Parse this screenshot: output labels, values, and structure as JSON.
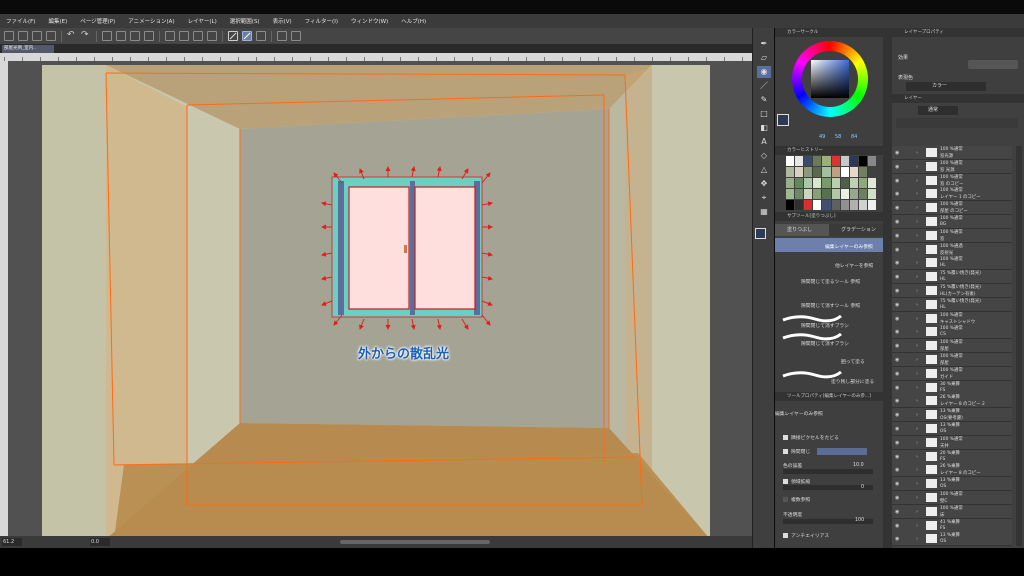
{
  "menubar": {
    "items": [
      "ファイル(F)",
      "編集(E)",
      "ページ管理(P)",
      "アニメーション(A)",
      "レイヤー(L)",
      "選択範囲(S)",
      "表示(V)",
      "フィルター(I)",
      "ウィンドウ(W)",
      "ヘルプ(H)"
    ]
  },
  "document": {
    "tab_title": "部屋光例_室内.."
  },
  "canvas": {
    "annotation": "外からの散乱光"
  },
  "status": {
    "zoom": "61.2",
    "angle": "0.0"
  },
  "colorwheel_panel": {
    "title": "カラーサークル",
    "values": [
      "49",
      "58",
      "84"
    ]
  },
  "history_panel": {
    "title": "カラーヒストリー"
  },
  "subtool_panel": {
    "title": "サブツール[塗りつぶし]",
    "tabs": [
      "塗りつぶし",
      "グラデーション"
    ],
    "items": [
      "編集レイヤーのみ参照",
      "他レイヤーを参照",
      "隙間閉じて塗るツール 参照",
      "隙間閉じて消すツール 参照",
      "隙間閉じて消すブラシ",
      "隙間閉じて消すブラシ",
      "囲って塗る",
      "塗り残し部分に塗る"
    ]
  },
  "toolprop_panel": {
    "title": "ツールプロパティ[編集レイヤーのみ参...]",
    "subtitle": "編集レイヤーのみ参照",
    "rows": {
      "follow_adjacent": "隣接ピクセルをたどる",
      "close_gap": "隙間閉じ",
      "color_margin": "色の誤差",
      "color_margin_value": "10.0",
      "area_scaling": "領域拡縮",
      "area_scaling_value": "0",
      "multi_ref": "複数参照",
      "opacity": "不透明度",
      "opacity_value": "100",
      "antialias": "アンチエイリアス"
    }
  },
  "layerprop_panel": {
    "title": "レイヤープロパティ",
    "effect_label": "効果",
    "expression_label": "表現色",
    "expression_value": "カラー"
  },
  "layer_panel": {
    "title": "レイヤー",
    "blend_mode": "通常",
    "layers": [
      {
        "blend": "100 %通常",
        "name": "窓光源"
      },
      {
        "blend": "100 %通常",
        "name": "窓 光源"
      },
      {
        "blend": "100 %通常",
        "name": "窓 のコピー"
      },
      {
        "blend": "100 %通常",
        "name": "レイヤー 1 のコピー"
      },
      {
        "blend": "100 %通常",
        "name": "部屋 のコピー"
      },
      {
        "blend": "100 %通常",
        "name": "BG"
      },
      {
        "blend": "100 %通常",
        "name": "窓"
      },
      {
        "blend": "100 %通過",
        "name": "反射光"
      },
      {
        "blend": "100 %通常",
        "name": "HL"
      },
      {
        "blend": "75 %覆い焼き(発光)",
        "name": "HL"
      },
      {
        "blend": "75 %覆い焼き(発光)",
        "name": "HL(カーテン有後)"
      },
      {
        "blend": "75 %覆い焼き(発光)",
        "name": "HL"
      },
      {
        "blend": "100 %通常",
        "name": "キャストシャドウ"
      },
      {
        "blend": "100 %通常",
        "name": "CS"
      },
      {
        "blend": "100 %通常",
        "name": "部屋"
      },
      {
        "blend": "100 %通常",
        "name": "部屋"
      },
      {
        "blend": "100 %通常",
        "name": "ガイド"
      },
      {
        "blend": "30 %乗算",
        "name": "FS"
      },
      {
        "blend": "26 %乗算",
        "name": "レイヤー 8 のコピー 2"
      },
      {
        "blend": "13 %乗算",
        "name": "OS(要考慮)"
      },
      {
        "blend": "13 %乗算",
        "name": "OS"
      },
      {
        "blend": "100 %通常",
        "name": "天井"
      },
      {
        "blend": "20 %乗算",
        "name": "FS"
      },
      {
        "blend": "26 %乗算",
        "name": "レイヤー 8 のコピー"
      },
      {
        "blend": "13 %乗算",
        "name": "OS"
      },
      {
        "blend": "100 %通常",
        "name": "壁C"
      },
      {
        "blend": "100 %通常",
        "name": "床"
      },
      {
        "blend": "41 %乗算",
        "name": "FS"
      },
      {
        "blend": "13 %乗算",
        "name": "OS"
      }
    ]
  },
  "colors": {
    "wall_back": "#a6a494",
    "wall_left": "#c5c3aa",
    "floor": "#b48a4c",
    "guide_orange": "#ff6a1a",
    "arrow_red": "#e0201a",
    "annotation_blue": "#1c5fb8"
  }
}
